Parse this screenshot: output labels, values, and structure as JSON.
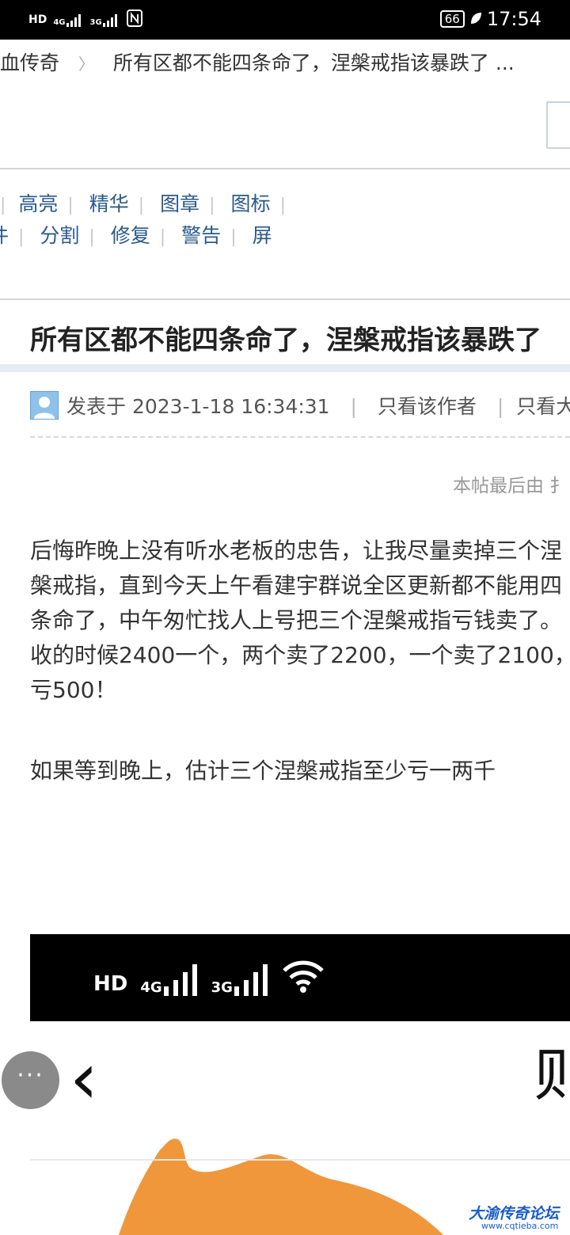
{
  "status_bar": {
    "network_left": "HD",
    "net1": "4G",
    "net2": "3G",
    "battery": "66",
    "time": "17:54"
  },
  "breadcrumb": {
    "forum": "血传奇",
    "thread": "所有区都不能四条命了，涅槃戒指该暴跌了 ..."
  },
  "toolbar": {
    "row1": [
      "高亮",
      "精华",
      "图章",
      "图标"
    ],
    "row2_lead": "件",
    "row2": [
      "分割",
      "修复",
      "警告",
      "屏"
    ]
  },
  "post": {
    "title": "所有区都不能四条命了，涅槃戒指该暴跌了",
    "posted_prefix": "发表于",
    "posted_time": "2023-1-18 16:34:31",
    "only_author": "只看该作者",
    "only_large": "只看大",
    "edit_note": "本帖最后由 扌",
    "paragraphs": [
      "后悔昨晚上没有听水老板的忠告，让我尽量卖掉三个涅槃戒指，直到今天上午看建宇群说全区更新都不能用四条命了，中午匆忙找人上号把三个涅槃戒指亏钱卖了。收的时候2400一个，两个卖了2200，一个卖了2100，亏500！",
      "如果等到晚上，估计三个涅槃戒指至少亏一两千"
    ]
  },
  "embedded_screenshot": {
    "status_text_hd": "HD",
    "net1": "4G",
    "net2": "3G",
    "partial_title": "则"
  },
  "more_button": "···",
  "watermark": {
    "name": "大渝传奇论坛",
    "url": "www.cqtieba.com"
  }
}
